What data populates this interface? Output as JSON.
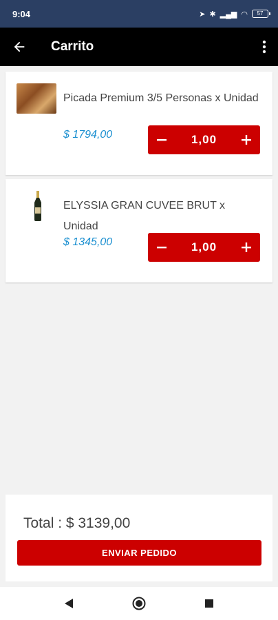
{
  "status_bar": {
    "time": "9:04",
    "battery": "57"
  },
  "app_bar": {
    "title": "Carrito"
  },
  "items": [
    {
      "name": "Picada Premium 3/5 Personas  x Unidad",
      "price": "$ 1794,00",
      "quantity": "1,00"
    },
    {
      "name": "ELYSSIA GRAN CUVEE BRUT x Unidad",
      "price": "$ 1345,00",
      "quantity": "1,00"
    }
  ],
  "footer": {
    "total": "Total : $ 3139,00",
    "send_label": "ENVIAR PEDIDO"
  },
  "icons": {
    "back": "arrow-left",
    "menu": "more-vert",
    "decrease": "minus",
    "increase": "plus"
  },
  "colors": {
    "accent": "#cc0000",
    "price": "#1b8fd0",
    "status_bar": "#2b3f63",
    "app_bar": "#000000"
  }
}
